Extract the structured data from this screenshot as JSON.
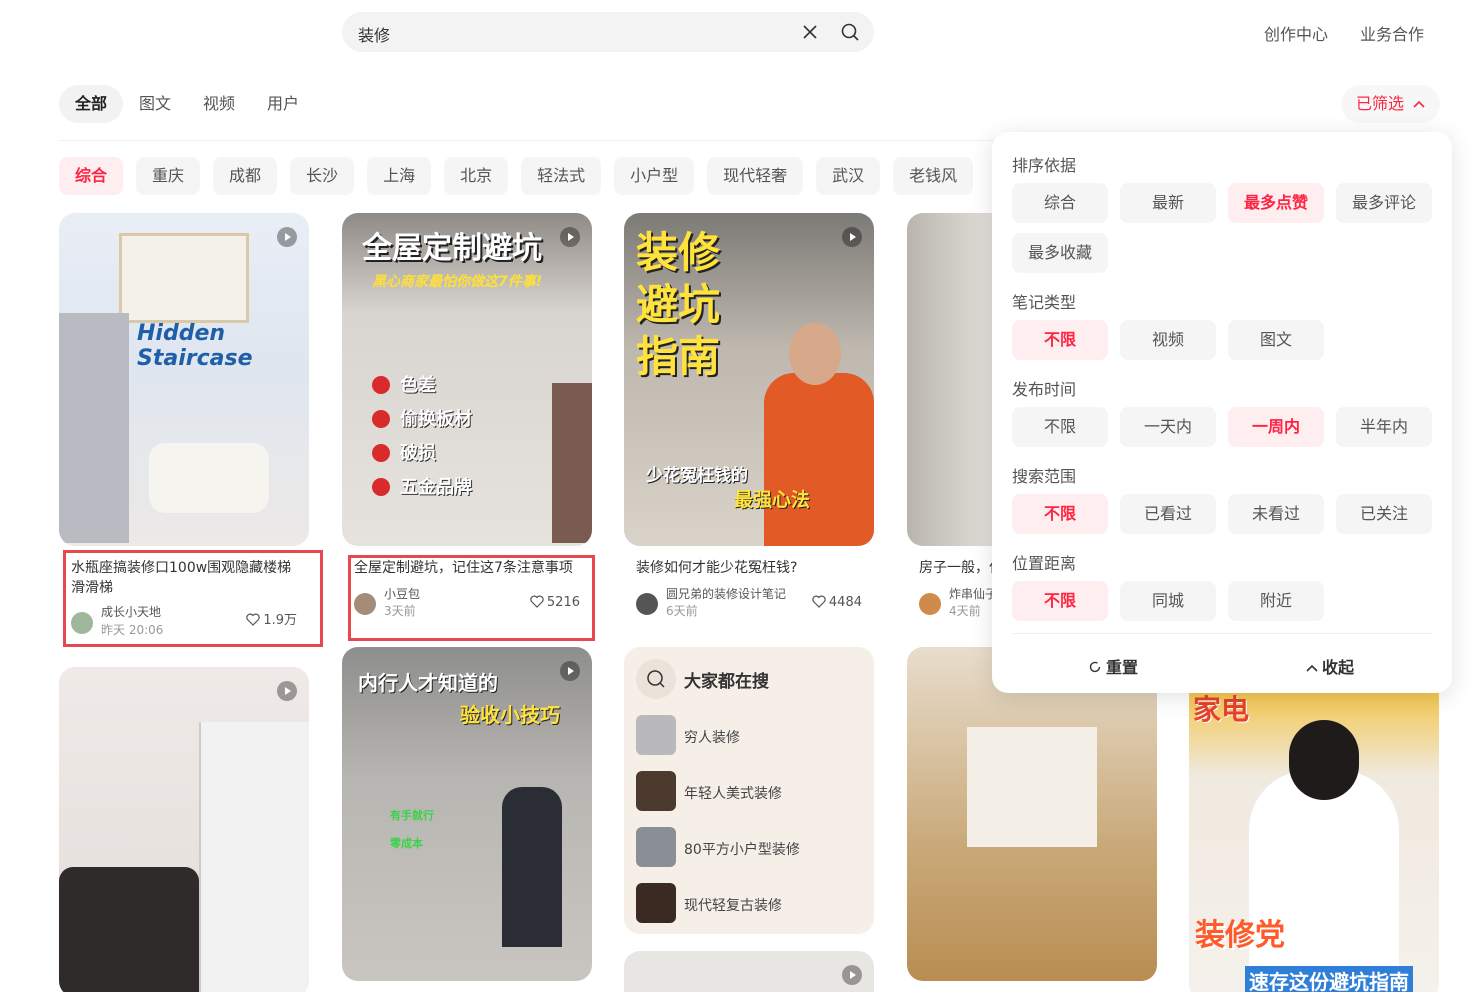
{
  "header": {
    "search_value": "装修",
    "links": [
      "创作中心",
      "业务合作"
    ]
  },
  "tabs": [
    "全部",
    "图文",
    "视频",
    "用户"
  ],
  "filter_button": "已筛选",
  "chips": [
    "综合",
    "重庆",
    "成都",
    "长沙",
    "上海",
    "北京",
    "轻法式",
    "小户型",
    "现代轻奢",
    "武汉",
    "老钱风"
  ],
  "cards": [
    {
      "title": "水瓶座搞装修口100w围观隐藏楼梯滑滑梯",
      "author": "成长小天地",
      "time": "昨天 20:06",
      "likes": "1.9万",
      "overlay": "Hidden Staircase"
    },
    {
      "title": "全屋定制避坑，记住这7条注意事项",
      "author": "小豆包",
      "time": "3天前",
      "likes": "5216",
      "overlay": "全屋定制避坑",
      "overlay_sub": "黑心商家最怕你做这7件事!",
      "overlay_list": [
        "色差",
        "偷换板材",
        "破损",
        "五金品牌"
      ]
    },
    {
      "title": "装修如何才能少花冤枉钱?",
      "author": "圆兄弟的装修设计笔记",
      "time": "6天前",
      "likes": "4484",
      "overlay": "装修避坑指南",
      "overlay_sub": "少花冤枉钱的",
      "overlay_sub2": "最强心法"
    },
    {
      "title": "房子一般，仅",
      "author": "炸串仙子",
      "time": "4天前",
      "likes": ""
    },
    {
      "overlay": "内行人才知道的",
      "overlay_sub": "验收小技巧",
      "marks": [
        "有手就行",
        "零成本"
      ]
    },
    {
      "overlay": "装修党",
      "overlay_sub": "速存这份避坑指南",
      "overlay_top": "家电"
    }
  ],
  "suggest": {
    "title": "大家都在搜",
    "items": [
      "穷人装修",
      "年轻人美式装修",
      "80平方小户型装修",
      "现代轻复古装修"
    ]
  },
  "popup": {
    "sections": [
      {
        "label": "排序依据",
        "options": [
          "综合",
          "最新",
          "最多点赞",
          "最多评论",
          "最多收藏"
        ],
        "active": 2
      },
      {
        "label": "笔记类型",
        "options": [
          "不限",
          "视频",
          "图文"
        ],
        "active": 0
      },
      {
        "label": "发布时间",
        "options": [
          "不限",
          "一天内",
          "一周内",
          "半年内"
        ],
        "active": 2
      },
      {
        "label": "搜索范围",
        "options": [
          "不限",
          "已看过",
          "未看过",
          "已关注"
        ],
        "active": 0
      },
      {
        "label": "位置距离",
        "options": [
          "不限",
          "同城",
          "附近"
        ],
        "active": 0
      }
    ],
    "reset": "重置",
    "collapse": "收起"
  },
  "colors": {
    "accent": "#ff2442",
    "highlight_box": "#e5484d"
  }
}
